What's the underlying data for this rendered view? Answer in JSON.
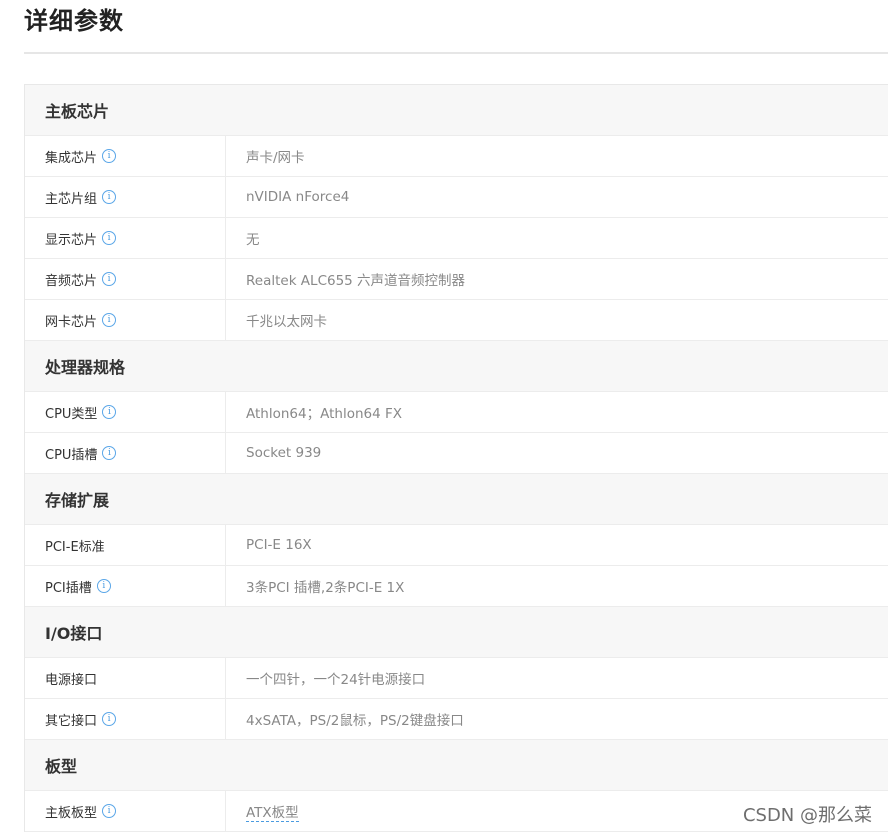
{
  "page": {
    "title": "详细参数"
  },
  "sections": [
    {
      "title": "主板芯片",
      "rows": [
        {
          "label": "集成芯片",
          "info": true,
          "value": "声卡/网卡"
        },
        {
          "label": "主芯片组",
          "info": true,
          "value": "nVIDIA nForce4"
        },
        {
          "label": "显示芯片",
          "info": true,
          "value": "无"
        },
        {
          "label": "音频芯片",
          "info": true,
          "value": "Realtek ALC655 六声道音频控制器"
        },
        {
          "label": "网卡芯片",
          "info": true,
          "value": "千兆以太网卡"
        }
      ]
    },
    {
      "title": "处理器规格",
      "rows": [
        {
          "label": "CPU类型",
          "info": true,
          "value": "Athlon64；Athlon64 FX"
        },
        {
          "label": "CPU插槽",
          "info": true,
          "value": "Socket 939"
        }
      ]
    },
    {
      "title": "存储扩展",
      "rows": [
        {
          "label": "PCI-E标准",
          "info": false,
          "value": "PCI-E 16X"
        },
        {
          "label": "PCI插槽",
          "info": true,
          "value": "3条PCI 插槽,2条PCI-E 1X"
        }
      ]
    },
    {
      "title": "I/O接口",
      "rows": [
        {
          "label": "电源接口",
          "info": false,
          "value": "一个四针，一个24针电源接口"
        },
        {
          "label": "其它接口",
          "info": true,
          "value": "4xSATA，PS/2鼠标，PS/2键盘接口"
        }
      ]
    },
    {
      "title": "板型",
      "rows": [
        {
          "label": "主板板型",
          "info": true,
          "value": "ATX板型",
          "link": true
        }
      ]
    }
  ],
  "icons": {
    "info": "info-icon",
    "info_glyph": "i"
  },
  "watermark": "CSDN @那么菜"
}
